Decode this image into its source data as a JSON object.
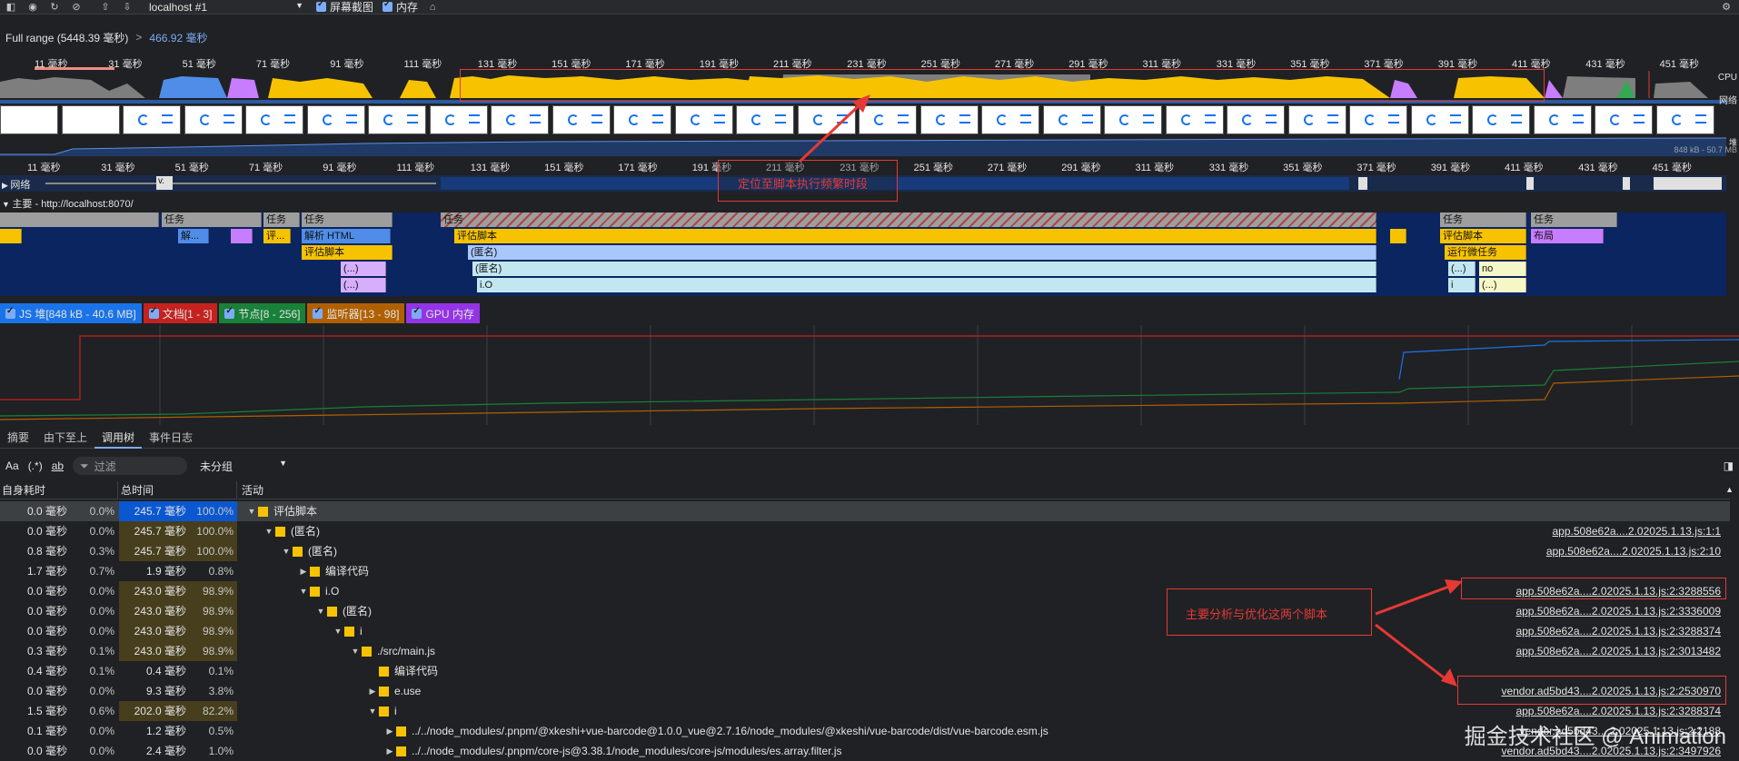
{
  "toolbar": {
    "target": "localhost #1",
    "screenshots_label": "屏幕截图",
    "memory_label": "内存"
  },
  "range": {
    "full": "Full range (5448.39 毫秒)",
    "sep": ">",
    "selected": "466.92 毫秒"
  },
  "overview_ticks": [
    "11 毫秒",
    "31 毫秒",
    "51 毫秒",
    "71 毫秒",
    "91 毫秒",
    "111 毫秒",
    "131 毫秒",
    "151 毫秒",
    "171 毫秒",
    "191 毫秒",
    "211 毫秒",
    "231 毫秒",
    "251 毫秒",
    "271 毫秒",
    "291 毫秒",
    "311 毫秒",
    "331 毫秒",
    "351 毫秒",
    "371 毫秒",
    "391 毫秒",
    "411 毫秒",
    "431 毫秒",
    "451 毫秒"
  ],
  "overview_labels": {
    "cpu": "CPU",
    "net": "网络",
    "heap": "堆",
    "heap_range": "848 kB - 50.7 MB"
  },
  "track_ticks": [
    "11 毫秒",
    "31 毫秒",
    "51 毫秒",
    "71 毫秒",
    "91 毫秒",
    "111 毫秒",
    "131 毫秒",
    "151 毫秒",
    "171 毫秒",
    "191 毫秒",
    "211 毫秒",
    "231 毫秒",
    "251 毫秒",
    "271 毫秒",
    "291 毫秒",
    "311 毫秒",
    "331 毫秒",
    "351 毫秒",
    "371 毫秒",
    "391 毫秒",
    "411 毫秒",
    "431 毫秒",
    "451 毫秒"
  ],
  "tracks": {
    "network": "网络",
    "net_item": "v.",
    "main": "主要 - http://localhost:8070/"
  },
  "flame": {
    "task": "任务",
    "parse_short": "解...",
    "eval_short": "评...",
    "parse_html": "解析 HTML",
    "eval_script": "评估脚本",
    "anon": "(匿名)",
    "ellipsis": "(...)",
    "io": "i.O",
    "layout": "布局",
    "microtasks": "运行微任务",
    "no": "no",
    "i": "i"
  },
  "counters": [
    {
      "label": "JS 堆[848 kB - 40.6 MB]",
      "color": "#1a73e8"
    },
    {
      "label": "文档[1 - 3]",
      "color": "#c5221f"
    },
    {
      "label": "节点[8 - 256]",
      "color": "#188038"
    },
    {
      "label": "监听器[13 - 98]",
      "color": "#b06000"
    },
    {
      "label": "GPU 内存",
      "color": "#9334e6"
    }
  ],
  "tabs": [
    "摘要",
    "由下至上",
    "调用树",
    "事件日志"
  ],
  "active_tab": "调用树",
  "filter": {
    "aa": "Aa",
    "regex": "(.*)",
    "ab": "ab",
    "placeholder": "过滤",
    "group": "未分组"
  },
  "columns": {
    "self": "自身耗时",
    "total": "总时间",
    "activity": "活动"
  },
  "rows": [
    {
      "self": "0.0 毫秒",
      "self_pct": "0.0%",
      "total": "245.7 毫秒",
      "total_pct": "100.0%",
      "name": "评估脚本",
      "link": ""
    },
    {
      "self": "0.0 毫秒",
      "self_pct": "0.0%",
      "total": "245.7 毫秒",
      "total_pct": "100.0%",
      "name": "(匿名)",
      "link": "app.508e62a....2.02025.1.13.js:1:1"
    },
    {
      "self": "0.8 毫秒",
      "self_pct": "0.3%",
      "total": "245.7 毫秒",
      "total_pct": "100.0%",
      "name": "(匿名)",
      "link": "app.508e62a....2.02025.1.13.js:2:10"
    },
    {
      "self": "1.7 毫秒",
      "self_pct": "0.7%",
      "total": "1.9 毫秒",
      "total_pct": "0.8%",
      "name": "编译代码",
      "link": ""
    },
    {
      "self": "0.0 毫秒",
      "self_pct": "0.0%",
      "total": "243.0 毫秒",
      "total_pct": "98.9%",
      "name": "i.O",
      "link": "app.508e62a....2.02025.1.13.js:2:3288556"
    },
    {
      "self": "0.0 毫秒",
      "self_pct": "0.0%",
      "total": "243.0 毫秒",
      "total_pct": "98.9%",
      "name": "(匿名)",
      "link": "app.508e62a....2.02025.1.13.js:2:3336009"
    },
    {
      "self": "0.0 毫秒",
      "self_pct": "0.0%",
      "total": "243.0 毫秒",
      "total_pct": "98.9%",
      "name": "i",
      "link": "app.508e62a....2.02025.1.13.js:2:3288374"
    },
    {
      "self": "0.3 毫秒",
      "self_pct": "0.1%",
      "total": "243.0 毫秒",
      "total_pct": "98.9%",
      "name": "./src/main.js",
      "link": "app.508e62a....2.02025.1.13.js:2:3013482"
    },
    {
      "self": "0.4 毫秒",
      "self_pct": "0.1%",
      "total": "0.4 毫秒",
      "total_pct": "0.1%",
      "name": "编译代码",
      "link": ""
    },
    {
      "self": "0.0 毫秒",
      "self_pct": "0.0%",
      "total": "9.3 毫秒",
      "total_pct": "3.8%",
      "name": "e.use",
      "link": "vendor.ad5bd43....2.02025.1.13.js:2:2530970"
    },
    {
      "self": "1.5 毫秒",
      "self_pct": "0.6%",
      "total": "202.0 毫秒",
      "total_pct": "82.2%",
      "name": "i",
      "link": "app.508e62a....2.02025.1.13.js:2:3288374"
    },
    {
      "self": "0.1 毫秒",
      "self_pct": "0.0%",
      "total": "1.2 毫秒",
      "total_pct": "0.5%",
      "name": "../../node_modules/.pnpm/@xkeshi+vue-barcode@1.0.0_vue@2.7.16/node_modules/@xkeshi/vue-barcode/dist/vue-barcode.esm.js",
      "link": "vendor.ad5bd43....2.02025.1.13.js:2:2188"
    },
    {
      "self": "0.0 毫秒",
      "self_pct": "0.0%",
      "total": "2.4 毫秒",
      "total_pct": "1.0%",
      "name": "../../node_modules/.pnpm/core-js@3.38.1/node_modules/core-js/modules/es.array.filter.js",
      "link": "vendor.ad5bd43....2.02025.1.13.js:2:3497926"
    }
  ],
  "annotations": {
    "top": "定位至脚本执行频繁时段",
    "right": "主要分析与优化这两个脚本"
  },
  "watermark": "掘金技术社区 @ Animation"
}
